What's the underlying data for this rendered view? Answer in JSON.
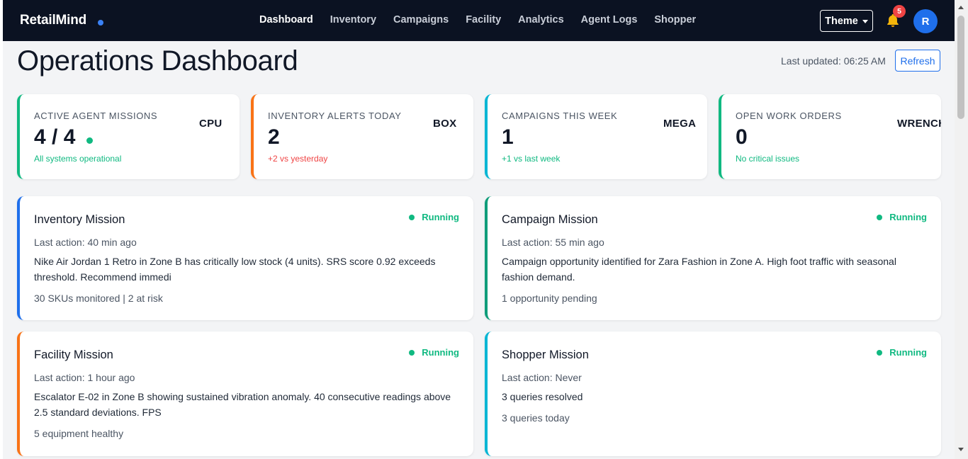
{
  "navbar": {
    "brand": "RetailMind",
    "links": [
      "Dashboard",
      "Inventory",
      "Campaigns",
      "Facility",
      "Analytics",
      "Agent Logs",
      "Shopper"
    ],
    "theme_label": "Theme",
    "notification_count": "5",
    "avatar_initial": "R",
    "colors": {
      "background": "#0b1222",
      "brand_dot": "#3b82f6",
      "badge": "#ef4444",
      "avatar": "#1f6feb"
    }
  },
  "header": {
    "title": "Operations Dashboard",
    "last_updated": "Last updated: 06:25 AM",
    "refresh_label": "Refresh"
  },
  "stats": [
    {
      "label": "Active Agent Missions",
      "value": "4 / 4",
      "sub": "All systems operational",
      "icon_text": "CPU",
      "accent": "#10b981",
      "sub_color": "#10b981",
      "icon": "cpu-icon"
    },
    {
      "label": "Inventory Alerts Today",
      "value": "2",
      "sub": "+2 vs yesterday",
      "icon_text": "BOX",
      "accent": "#f97316",
      "sub_color": "#ef4444",
      "icon": "box-icon"
    },
    {
      "label": "Campaigns This Week",
      "value": "1",
      "sub": "+1 vs last week",
      "icon_text": "MEGA",
      "accent": "#06b6d4",
      "sub_color": "#10b981",
      "icon": "megaphone-icon"
    },
    {
      "label": "Open Work Orders",
      "value": "0",
      "sub": "No critical issues",
      "icon_text": "WRENCH",
      "accent": "#10b981",
      "sub_color": "#10b981",
      "icon": "wrench-icon"
    }
  ],
  "missions": [
    {
      "title": "Inventory Mission",
      "status": "Running",
      "last_action": "Last action: 40 min ago",
      "description": "Nike Air Jordan 1 Retro in Zone B has critically low stock (4 units). SRS score 0.92 exceeds threshold. Recommend immedi",
      "footer": "30 SKUs monitored | 2 at risk",
      "accent": "#1f6feb"
    },
    {
      "title": "Campaign Mission",
      "status": "Running",
      "last_action": "Last action: 55 min ago",
      "description": "Campaign opportunity identified for Zara Fashion in Zone A. High foot traffic with seasonal fashion demand.",
      "footer": "1 opportunity pending",
      "accent": "#0f9d7a"
    },
    {
      "title": "Facility Mission",
      "status": "Running",
      "last_action": "Last action: 1 hour ago",
      "description": "Escalator E-02 in Zone B showing sustained vibration anomaly. 40 consecutive readings above 2.5 standard deviations. FPS",
      "footer": "5 equipment healthy",
      "accent": "#f97316"
    },
    {
      "title": "Shopper Mission",
      "status": "Running",
      "last_action": "Last action: Never",
      "description": "3 queries resolved",
      "footer": "3 queries today",
      "accent": "#06b6d4"
    }
  ]
}
